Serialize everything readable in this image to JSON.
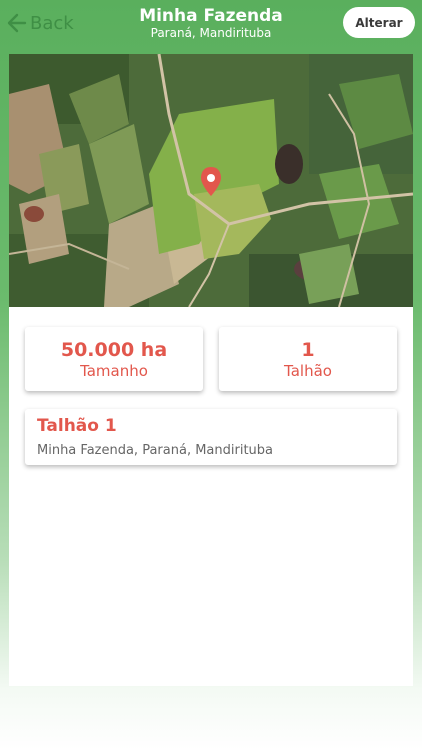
{
  "header": {
    "back_label": "Back",
    "title": "Minha Fazenda",
    "subtitle": "Paraná, Mandirituba",
    "action_label": "Alterar"
  },
  "stats": [
    {
      "value": "50.000 ha",
      "label": "Tamanho"
    },
    {
      "value": "1",
      "label": "Talhão"
    }
  ],
  "plots": [
    {
      "name": "Talhão 1",
      "location": "Minha Fazenda, Paraná, Mandirituba"
    }
  ],
  "colors": {
    "accent": "#e2574c",
    "header_green": "#5aaf5d",
    "back_green": "#3f8f45"
  },
  "icons": {
    "back": "arrow-left-icon",
    "pin": "map-pin-icon"
  }
}
